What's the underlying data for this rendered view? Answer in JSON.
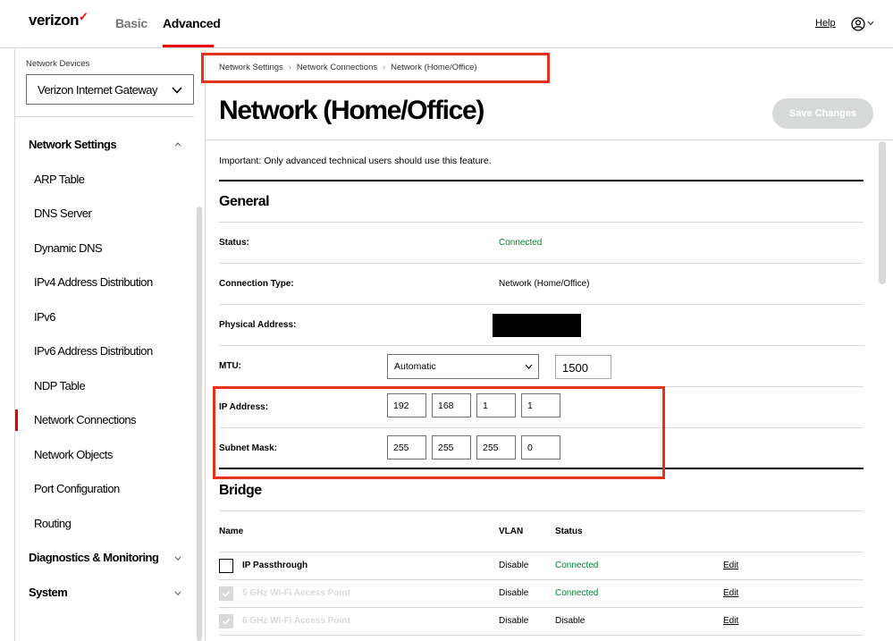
{
  "header": {
    "brand": "verizon",
    "brand_check": "✓",
    "tabs": [
      {
        "label": "Basic"
      },
      {
        "label": "Advanced"
      }
    ],
    "active_tab": "Advanced",
    "help_label": "Help",
    "accent_color": "#ee0000"
  },
  "sidebar": {
    "devices_label": "Network Devices",
    "device_selected": "Verizon Internet Gateway",
    "group_network": "Network Settings",
    "items": [
      {
        "label": "ARP Table"
      },
      {
        "label": "DNS Server"
      },
      {
        "label": "Dynamic DNS"
      },
      {
        "label": "IPv4 Address Distribution"
      },
      {
        "label": "IPv6"
      },
      {
        "label": "IPv6 Address Distribution"
      },
      {
        "label": "NDP Table"
      },
      {
        "label": "Network Connections"
      },
      {
        "label": "Network Objects"
      },
      {
        "label": "Port Configuration"
      },
      {
        "label": "Routing"
      }
    ],
    "active_item": "Network Connections",
    "group_diagnostics": "Diagnostics & Monitoring",
    "group_system": "System"
  },
  "breadcrumb": [
    "Network Settings",
    "Network Connections",
    "Network (Home/Office)"
  ],
  "page": {
    "title": "Network (Home/Office)",
    "save_label": "Save Changes",
    "important": "Important: Only advanced technical users should use this feature."
  },
  "general": {
    "title": "General",
    "status_label": "Status:",
    "status_value": "Connected",
    "conn_type_label": "Connection Type:",
    "conn_type_value": "Network (Home/Office)",
    "physical_label": "Physical Address:",
    "mtu_label": "MTU:",
    "mtu_mode": "Automatic",
    "mtu_value": "1500",
    "ip_label": "IP Address:",
    "ip": [
      "192",
      "168",
      "1",
      "1"
    ],
    "subnet_label": "Subnet Mask:",
    "subnet": [
      "255",
      "255",
      "255",
      "0"
    ]
  },
  "bridge": {
    "title": "Bridge",
    "columns": {
      "name": "Name",
      "vlan": "VLAN",
      "status": "Status"
    },
    "rows": [
      {
        "name": "IP Passthrough",
        "vlan": "Disable",
        "status": "Connected",
        "edit": "Edit",
        "checked": false
      },
      {
        "name": "5 GHz Wi-Fi Access Point",
        "vlan": "Disable",
        "status": "Connected",
        "edit": "Edit",
        "checked": true
      },
      {
        "name": "6 GHz Wi-Fi Access Point",
        "vlan": "Disable",
        "status": "Disable",
        "edit": "Edit",
        "checked": true
      }
    ]
  },
  "colors": {
    "connected": "#008331",
    "highlight_box": "#e8311a"
  }
}
